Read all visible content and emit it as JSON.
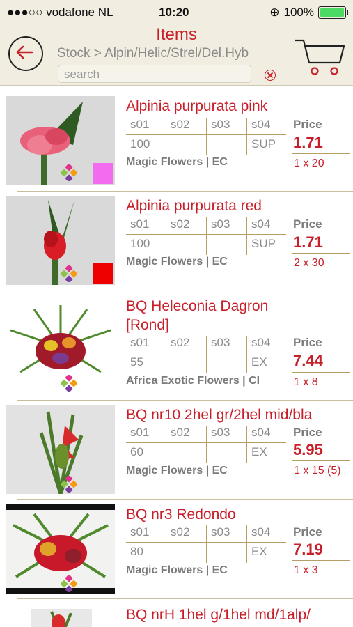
{
  "status_bar": {
    "carrier": "●●●○○ vodafone NL",
    "time": "10:20",
    "battery": "100%"
  },
  "header": {
    "title": "Items",
    "breadcrumb": "Stock > Alpin/Helic/Strel/Del.Hyb",
    "search_placeholder": "search"
  },
  "columns": {
    "c1": "s01",
    "c2": "s02",
    "c3": "s03",
    "c4": "s04",
    "price_label": "Price"
  },
  "colors": {
    "accent": "#c8202a",
    "header_bg": "#f1ede0",
    "rule": "#b79d66"
  },
  "items": [
    {
      "name": "Alpinia purpurata pink",
      "s01": "100",
      "s02": "",
      "s03": "",
      "s04": "SUP",
      "supplier": "Magic Flowers | EC",
      "price": "1.71",
      "pack": "1 x 20",
      "swatch": "#f36cf0",
      "icon": "pink-ginger-flower-image"
    },
    {
      "name": "Alpinia purpurata red",
      "s01": "100",
      "s02": "",
      "s03": "",
      "s04": "SUP",
      "supplier": "Magic Flowers | EC",
      "price": "1.71",
      "pack": "2 x 30",
      "swatch": "#ee0000",
      "icon": "red-ginger-flower-image"
    },
    {
      "name_line1": "BQ Heleconia Dagron",
      "name_line2": "[Rond]",
      "s01": "55",
      "s02": "",
      "s03": "",
      "s04": "EX",
      "supplier": "Africa Exotic Flowers | CI",
      "price": "7.44",
      "pack": "1 x 8",
      "icon": "tropical-bouquet-image"
    },
    {
      "name": "BQ nr10 2hel gr/2hel mid/bla",
      "s01": "60",
      "s02": "",
      "s03": "",
      "s04": "EX",
      "supplier": "Magic Flowers | EC",
      "price": "5.95",
      "pack": "1 x 15 (5)",
      "icon": "heliconia-bouquet-image"
    },
    {
      "name": "BQ nr3 Redondo",
      "s01": "80",
      "s02": "",
      "s03": "",
      "s04": "EX",
      "supplier": "Magic Flowers | EC",
      "price": "7.19",
      "pack": "1 x 3",
      "icon": "round-bouquet-image"
    },
    {
      "name": "BQ nrH 1hel g/1hel md/1alp/"
    }
  ]
}
